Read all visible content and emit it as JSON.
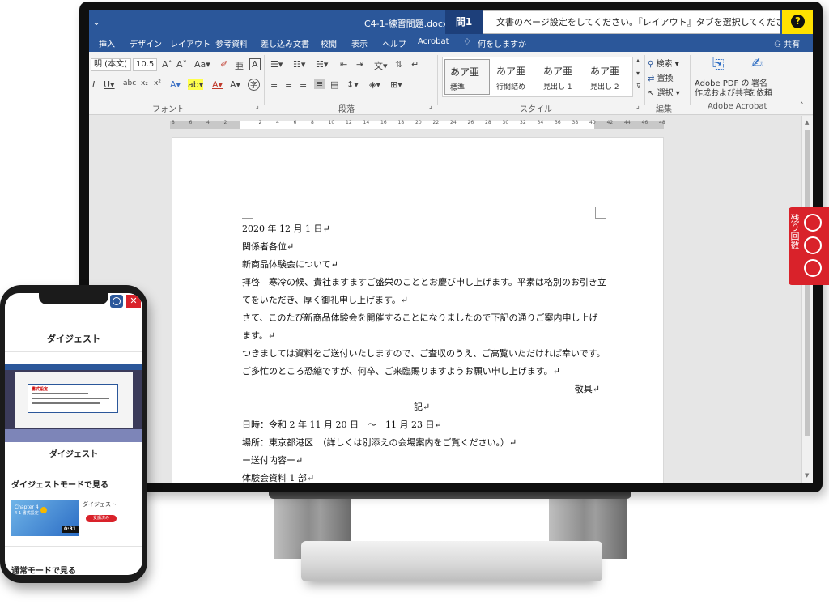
{
  "word": {
    "title": "C4-1-練習問題.docx -",
    "menu": [
      "挿入",
      "デザイン",
      "レイアウト",
      "参考資料",
      "差し込み文書",
      "校閲",
      "表示",
      "ヘルプ",
      "Acrobat"
    ],
    "tell_me": "何をしますか",
    "share": "共有",
    "ribbon": {
      "font_name": "明 (本文(",
      "font_size": "10.5",
      "font_group": "フォント",
      "paragraph_group": "段落",
      "style_group": "スタイル",
      "editing_group": "編集",
      "acrobat_group": "Adobe Acrobat",
      "styles": [
        {
          "sample": "あア亜",
          "name": "標準"
        },
        {
          "sample": "あア亜",
          "name": "行間詰め"
        },
        {
          "sample": "あア亜",
          "name": "見出し 1"
        },
        {
          "sample": "あア亜",
          "name": "見出し 2"
        }
      ],
      "search": "検索",
      "replace": "置換",
      "select": "選択",
      "acrobat_create_1": "Adobe PDF の",
      "acrobat_create_2": "作成および共有",
      "acrobat_sign_1": "署名",
      "acrobat_sign_2": "を依頼"
    },
    "ruler_ticks": [
      "8",
      "6",
      "4",
      "2",
      "",
      "2",
      "4",
      "6",
      "8",
      "10",
      "12",
      "14",
      "16",
      "18",
      "20",
      "22",
      "24",
      "26",
      "28",
      "30",
      "32",
      "34",
      "36",
      "38",
      "40",
      "42",
      "44",
      "46",
      "48"
    ],
    "document": {
      "lines": [
        "2020 年 12 月 1 日↵",
        "関係者各位↵",
        "新商品体験会について↵",
        "拝啓　寒冷の候、貴社ますますご盛栄のこととお慶び申し上げます。平素は格別のお引き立",
        "てをいただき、厚く御礼申し上げます。↵",
        "さて、このたび新商品体験会を開催することになりましたので下記の通りご案内申し上げ",
        "ます。↵",
        "つきましては資料をご送付いたしますので、ご査収のうえ、ご高覧いただければ幸いです。",
        "ご多忙のところ恐縮ですが、何卒、ご来臨賜りますようお願い申し上げます。↵"
      ],
      "closing": "敬具↵",
      "ki": "記↵",
      "lines2": [
        "日時：令和 2 年 11 月 20 日　～　11 月 23 日↵",
        "場所：東京都港区　（詳しくは別添えの会場案内をご覧ください。）↵",
        "ー送付内容ー↵",
        "体験会資料 1 部↵"
      ]
    }
  },
  "question": {
    "label": "問1",
    "text": "文書のページ設定をしてください。『レイアウト』タブを選択してください。",
    "help_glyph": "?"
  },
  "remaining": {
    "label": "残り回数",
    "count": 3
  },
  "phone": {
    "close_glyph": "✕",
    "heading": "ダイジェスト",
    "video_card_title": "書式設定",
    "video_card_text": "表紙のサイズや余白といった全体の設定をおこないます。",
    "subheading": "ダイジェスト",
    "digest_section": "ダイジェストモードで見る",
    "item_title": "ダイジェスト",
    "item_badge": "受講済み",
    "thumb_chapter": "Chapter 4",
    "thumb_sub": "4-1 書式設定",
    "duration": "0:31",
    "normal_section": "通常モードで見る"
  },
  "colors": {
    "word_blue": "#2b579a",
    "question_yellow": "#ffe100",
    "accent_red": "#d9222a"
  }
}
